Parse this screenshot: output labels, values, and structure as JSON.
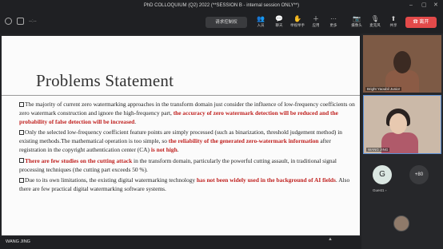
{
  "window": {
    "title": "PhD COLLOQUIUM (Q2) 2022 (**SESSION B - internal session ONLY**)"
  },
  "toolbar": {
    "view_button": "请求控制权",
    "tools": [
      {
        "label": "入员",
        "icon": "people-icon"
      },
      {
        "label": "聊天",
        "icon": "chat-icon"
      },
      {
        "label": "举视举手",
        "icon": "raise-hand-icon"
      },
      {
        "label": "应用",
        "icon": "apps-icon"
      },
      {
        "label": "更多",
        "icon": "more-icon"
      },
      {
        "label": "摄像头",
        "icon": "camera-icon"
      },
      {
        "label": "麦克风",
        "icon": "mic-icon"
      },
      {
        "label": "共享",
        "icon": "share-icon"
      }
    ],
    "leave_button": "离开",
    "dash": "--:--"
  },
  "slide": {
    "title": "Problems Statement",
    "bullets": [
      {
        "parts": [
          {
            "t": "The majority of current zero watermarking approaches in the transform domain just consider the influence of low-frequency coefficients on zero watermark construction and ignore the high-frequency part, ",
            "red": false
          },
          {
            "t": "the accuracy of zero watermark detection will be reduced and the probability of false detection will be increased",
            "red": true
          },
          {
            "t": ".",
            "red": false
          }
        ]
      },
      {
        "parts": [
          {
            "t": "Only the selected low-frequency coefficient feature points are simply processed (such as binarization, threshold judgement method) in existing methods.The mathematical operation is too simple, so ",
            "red": false
          },
          {
            "t": "the reliability of the generated zero-watermark information",
            "red": true
          },
          {
            "t": " after registration in the copyright authentication center (CA) ",
            "red": false
          },
          {
            "t": "is not high",
            "red": true
          },
          {
            "t": ".",
            "red": false
          }
        ]
      },
      {
        "parts": [
          {
            "t": "There are few studies on the cutting attack",
            "red": true
          },
          {
            "t": " in the transform domain, particularly the powerful cutting assault, in traditional signal processing techniques (the cutting part exceeds 50 %).",
            "red": false
          }
        ]
      },
      {
        "parts": [
          {
            "t": "Due to its own limitations, the existing digital watermarking technology ",
            "red": false
          },
          {
            "t": "has not been widely used in the background of AI fields",
            "red": true
          },
          {
            "t": ". Also there are few practical digital watermarking software systems.",
            "red": false
          }
        ]
      }
    ]
  },
  "presenter": {
    "name": "WANG JING"
  },
  "participants": {
    "tile1_name": "Bright Yaoubil Junior",
    "tile2_name": "WANG JING",
    "guest_initial": "G",
    "more_count": "+80",
    "guest_name": "Guest1 ▫"
  },
  "colors": {
    "accent_red": "#c0211f",
    "leave": "#e34a4a"
  }
}
